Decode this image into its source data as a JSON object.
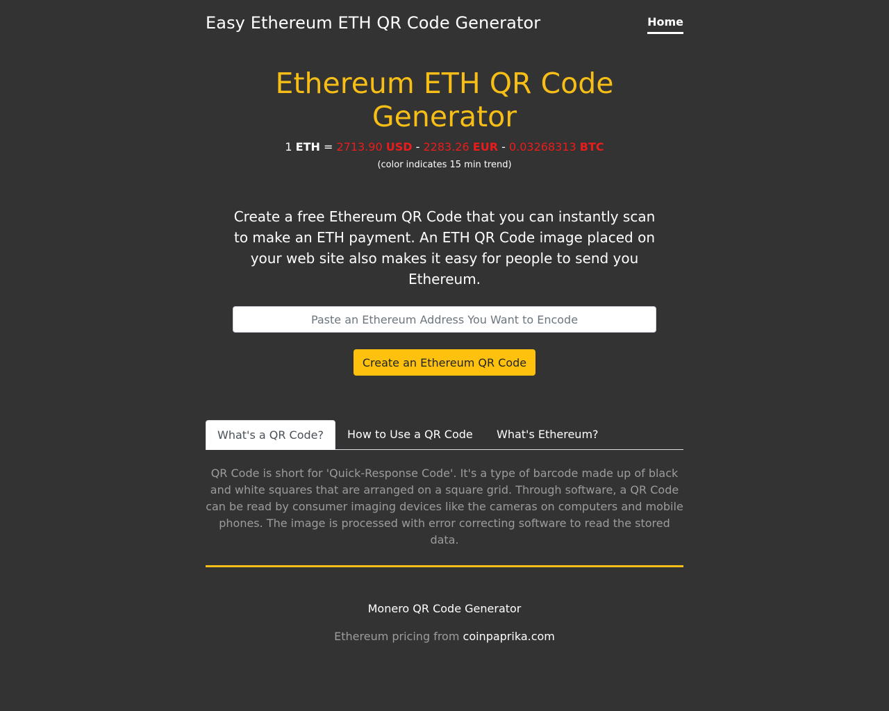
{
  "header": {
    "brand": "Easy Ethereum ETH QR Code Generator",
    "nav_home": "Home"
  },
  "hero": {
    "title": "Ethereum ETH QR Code Generator"
  },
  "prices": {
    "unit_amount": "1",
    "unit_symbol": "ETH",
    "equals": "=",
    "separator": "-",
    "usd_value": "2713.90",
    "usd_symbol": "USD",
    "eur_value": "2283.26",
    "eur_symbol": "EUR",
    "btc_value": "0.03268313",
    "btc_symbol": "BTC",
    "trend_note": "(color indicates 15 min trend)",
    "trend_color": "#ea1c1c"
  },
  "intro": {
    "text": "Create a free Ethereum QR Code that you can instantly scan to make an ETH payment. An ETH QR Code image placed on your web site also makes it easy for people to send you Ethereum."
  },
  "form": {
    "address_placeholder": "Paste an Ethereum Address You Want to Encode",
    "address_value": "",
    "create_button": "Create an Ethereum QR Code"
  },
  "tabs": {
    "items": [
      {
        "label": "What's a QR Code?",
        "active": true
      },
      {
        "label": "How to Use a QR Code",
        "active": false
      },
      {
        "label": "What's Ethereum?",
        "active": false
      }
    ],
    "active_content": "QR Code is short for 'Quick-Response Code'. It's a type of barcode made up of black and white squares that are arranged on a square grid. Through software, a QR Code can be read by consumer imaging devices like the cameras on computers and mobile phones. The image is processed with error correcting software to read the stored data."
  },
  "footer": {
    "related_link": "Monero QR Code Generator",
    "credit_prefix": "Ethereum pricing from",
    "credit_link": "coinpaprika.com"
  },
  "colors": {
    "background": "#333333",
    "accent": "#f6be16",
    "button": "#fec10e",
    "muted_text": "#9c9c9c"
  }
}
